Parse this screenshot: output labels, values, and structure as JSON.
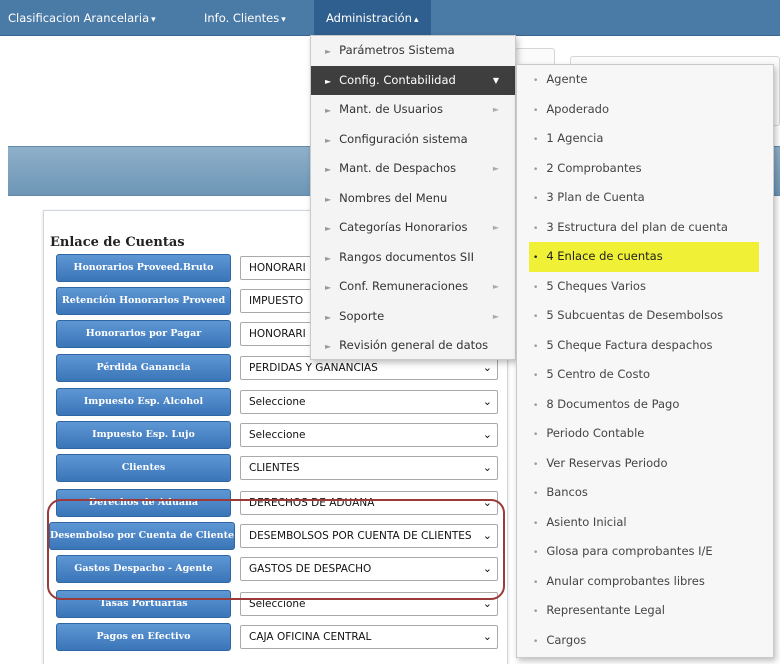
{
  "nav": {
    "items": [
      "Clasificacion Arancelaria",
      "Info. Clientes",
      "Administración"
    ]
  },
  "panel": {
    "title": "Enlace de Cuentas",
    "rows": [
      {
        "label": "Honorarios Proveed.Bruto",
        "value": "HONORARI"
      },
      {
        "label": "Retención Honorarios Proveed",
        "value": "IMPUESTO"
      },
      {
        "label": "Honorarios por Pagar",
        "value": "HONORARI"
      },
      {
        "label": "Pérdida Ganancia",
        "value": "PERDIDAS Y GANANCIAS"
      },
      {
        "label": "Impuesto Esp. Alcohol",
        "value": "Seleccione"
      },
      {
        "label": "Impuesto Esp. Lujo",
        "value": "Seleccione"
      },
      {
        "label": "Clientes",
        "value": "CLIENTES"
      },
      {
        "label": "Derechos de Aduana",
        "value": "DERECHOS DE ADUANA"
      },
      {
        "label": "Desembolso por Cuenta de Cliente",
        "value": "DESEMBOLSOS POR CUENTA DE CLIENTES"
      },
      {
        "label": "Gastos Despacho - Agente",
        "value": "GASTOS DE DESPACHO"
      },
      {
        "label": "Tasas Portuarias",
        "value": "Seleccione"
      },
      {
        "label": "Pagos en Efectivo",
        "value": "CAJA OFICINA CENTRAL"
      }
    ]
  },
  "admin_menu": {
    "items": [
      {
        "label": "Parámetros Sistema",
        "submenu": false
      },
      {
        "label": "Config. Contabilidad",
        "submenu": true,
        "selected": true
      },
      {
        "label": "Mant. de Usuarios",
        "submenu": true
      },
      {
        "label": "Configuración sistema",
        "submenu": false
      },
      {
        "label": "Mant. de Despachos",
        "submenu": true
      },
      {
        "label": "Nombres del Menu",
        "submenu": false
      },
      {
        "label": "Categorías Honorarios",
        "submenu": true
      },
      {
        "label": "Rangos documentos SII",
        "submenu": false
      },
      {
        "label": "Conf. Remuneraciones",
        "submenu": true
      },
      {
        "label": "Soporte",
        "submenu": true
      },
      {
        "label": "Revisión general de datos",
        "submenu": false
      }
    ]
  },
  "conta_menu": {
    "highlighted": "4 Enlace de cuentas",
    "highlight_color": "#f0f036",
    "items": [
      "Agente",
      "Apoderado",
      "1 Agencia",
      "2 Comprobantes",
      "3 Plan de Cuenta",
      "3 Estructura del plan de cuenta",
      "4 Enlace de cuentas",
      "5 Cheques Varios",
      "5 Subcuentas de Desembolsos",
      "5 Cheque Factura despachos",
      "5 Centro de Costo",
      "8 Documentos de Pago",
      "Periodo Contable",
      "Ver Reservas Periodo",
      "Bancos",
      "Asiento Inicial",
      "Glosa para comprobantes I/E",
      "Anular comprobantes libres",
      "Representante Legal",
      "Cargos"
    ]
  },
  "colors": {
    "nav_bg": "#4a7aa6",
    "label_bg": "#3a75b8",
    "highlight_border": "#9c3a3a"
  }
}
